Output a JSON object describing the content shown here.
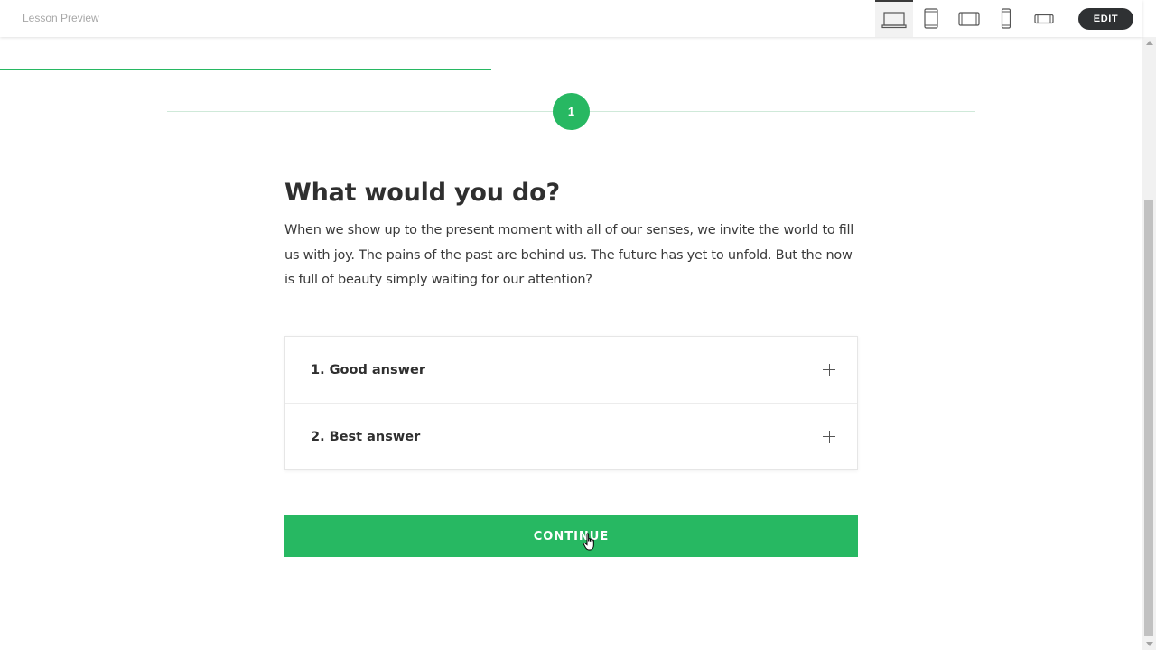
{
  "header": {
    "title": "Lesson Preview",
    "edit_label": "EDIT",
    "devices": [
      {
        "icon": "laptop-icon",
        "active": true
      },
      {
        "icon": "tablet-portrait-icon",
        "active": false
      },
      {
        "icon": "tablet-landscape-icon",
        "active": false
      },
      {
        "icon": "phone-portrait-icon",
        "active": false
      },
      {
        "icon": "phone-landscape-icon",
        "active": false
      }
    ]
  },
  "progress": {
    "fraction": 0.43,
    "color": "#27b862"
  },
  "lesson": {
    "step_number": "1",
    "heading": "What would you do?",
    "body": "When we show up to the present moment with all of our senses, we invite the world to fill us with joy. The pains of the past are behind us. The future has yet to unfold. But the now is full of beauty simply waiting for our attention?",
    "answers": [
      {
        "label": "1. Good answer"
      },
      {
        "label": "2. Best answer"
      }
    ],
    "continue_label": "CONTINUE"
  },
  "colors": {
    "accent": "#27b862",
    "edit_button": "#2f3133"
  }
}
